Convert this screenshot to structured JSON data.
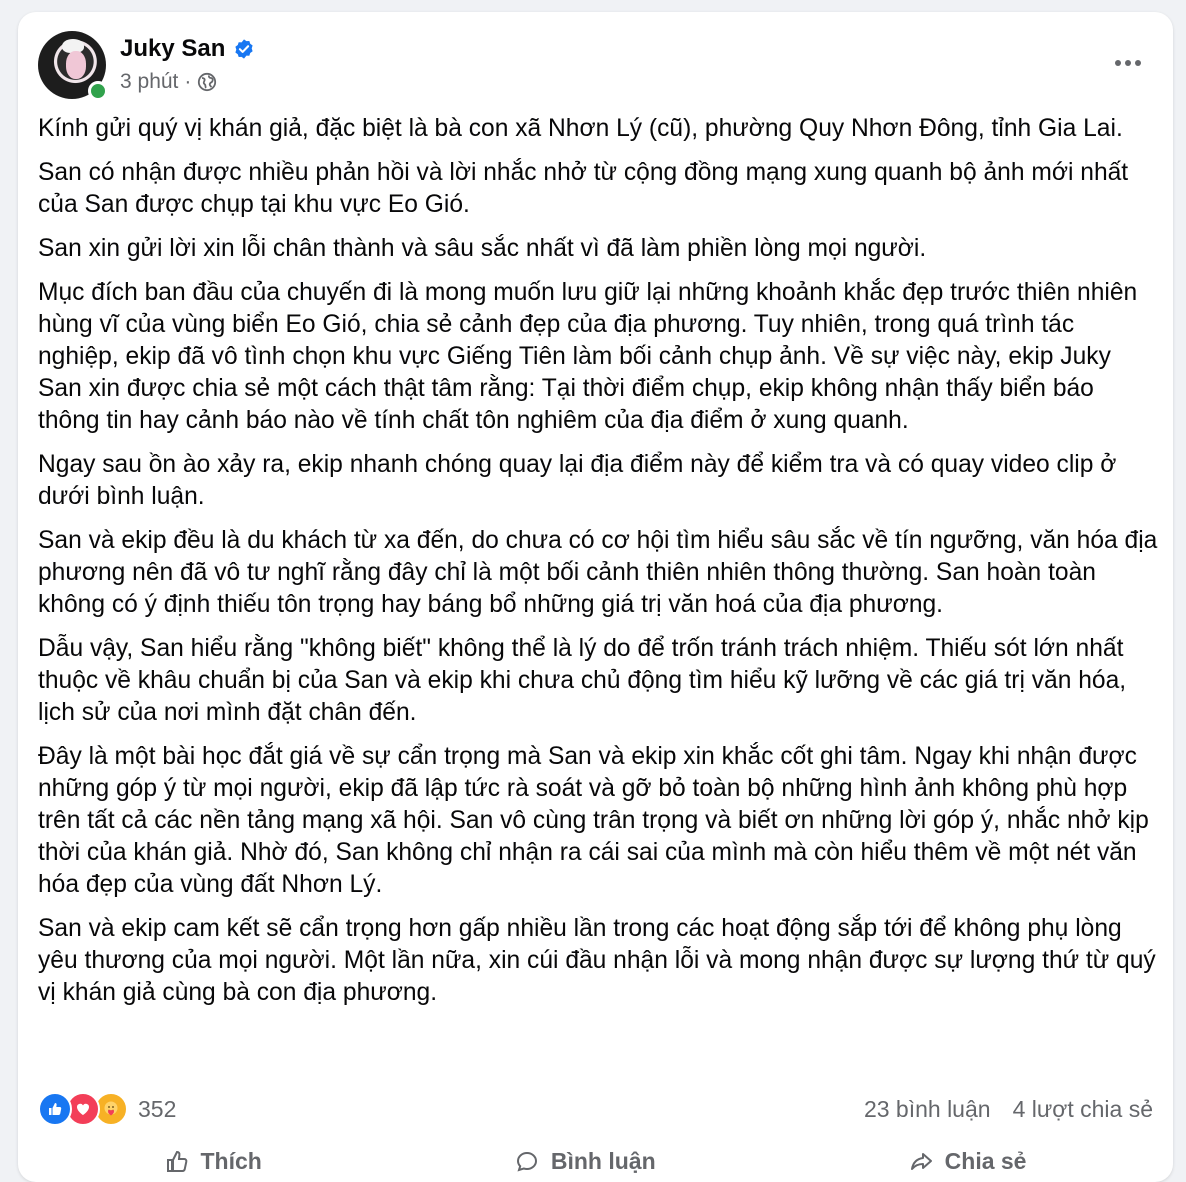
{
  "post": {
    "author": "Juky San",
    "time": "3 phút",
    "separator": "·",
    "paragraphs": [
      "Kính gửi quý vị khán giả, đặc biệt là bà con xã Nhơn Lý (cũ), phường Quy Nhơn Đông, tỉnh Gia Lai.",
      "San có nhận được nhiều phản hồi và lời nhắc nhở từ cộng đồng mạng xung quanh bộ ảnh mới nhất của San được chụp tại khu vực Eo Gió.",
      "San xin gửi lời xin lỗi chân thành và sâu sắc nhất vì đã làm phiền lòng mọi người.",
      "Mục đích ban đầu của chuyến đi là mong muốn lưu giữ lại những khoảnh khắc đẹp trước thiên nhiên hùng vĩ của vùng biển Eo Gió, chia sẻ cảnh đẹp của địa phương. Tuy nhiên, trong quá trình tác nghiệp, ekip đã vô tình chọn khu vực Giếng Tiên làm bối cảnh chụp ảnh. Về sự việc này, ekip Juky San xin được chia sẻ một cách thật tâm rằng: Tại thời điểm chụp, ekip không nhận thấy biển báo thông tin hay cảnh báo nào về tính chất tôn nghiêm của địa điểm ở xung quanh.",
      "Ngay sau ồn ào xảy ra, ekip nhanh chóng quay lại địa điểm này để kiểm tra và có quay video clip ở dưới bình luận.",
      "San và ekip đều là du khách từ xa đến, do chưa có cơ hội tìm hiểu sâu sắc về tín ngưỡng, văn hóa địa phương nên đã vô tư nghĩ rằng đây chỉ là một bối cảnh thiên nhiên thông thường. San hoàn toàn không có ý định thiếu tôn trọng hay báng bổ những giá trị văn hoá của địa phương.",
      "Dẫu vậy, San hiểu rằng \"không biết\" không thể là lý do để trốn tránh trách nhiệm. Thiếu sót lớn nhất thuộc về khâu chuẩn bị của San và ekip khi chưa chủ động tìm hiểu kỹ lưỡng về các giá trị văn hóa, lịch sử của nơi mình đặt chân đến.",
      "Đây là một bài học đắt giá về sự cẩn trọng mà San và ekip xin khắc cốt ghi tâm. Ngay khi nhận được những góp ý từ mọi người, ekip đã lập tức rà soát và gỡ bỏ toàn bộ những hình ảnh không phù hợp trên tất cả các nền tảng mạng xã hội. San vô cùng trân trọng và biết ơn những lời góp ý, nhắc nhở kịp thời của khán giả. Nhờ đó, San không chỉ nhận ra cái sai của mình mà còn hiểu thêm về một nét văn hóa đẹp của vùng đất Nhơn Lý.",
      "San và ekip cam kết sẽ cẩn trọng hơn gấp nhiều lần trong các hoạt động sắp tới để không phụ lòng yêu thương của mọi người. Một lần nữa, xin cúi đầu nhận lỗi và mong nhận được sự lượng thứ từ quý vị khán giả cùng bà con địa phương."
    ],
    "reaction_count": "352",
    "comments": "23 bình luận",
    "shares": "4 lượt chia sẻ",
    "actions": {
      "like": "Thích",
      "comment": "Bình luận",
      "share": "Chia sẻ"
    }
  },
  "colors": {
    "primary_text": "#080809",
    "secondary_text": "#65676b",
    "verified": "#1877f2",
    "online": "#31a24c"
  },
  "icons": [
    "verified-badge-icon",
    "globe-icon",
    "more-options-icon",
    "like-reaction-icon",
    "love-reaction-icon",
    "care-reaction-icon",
    "like-icon",
    "comment-icon",
    "share-icon"
  ]
}
